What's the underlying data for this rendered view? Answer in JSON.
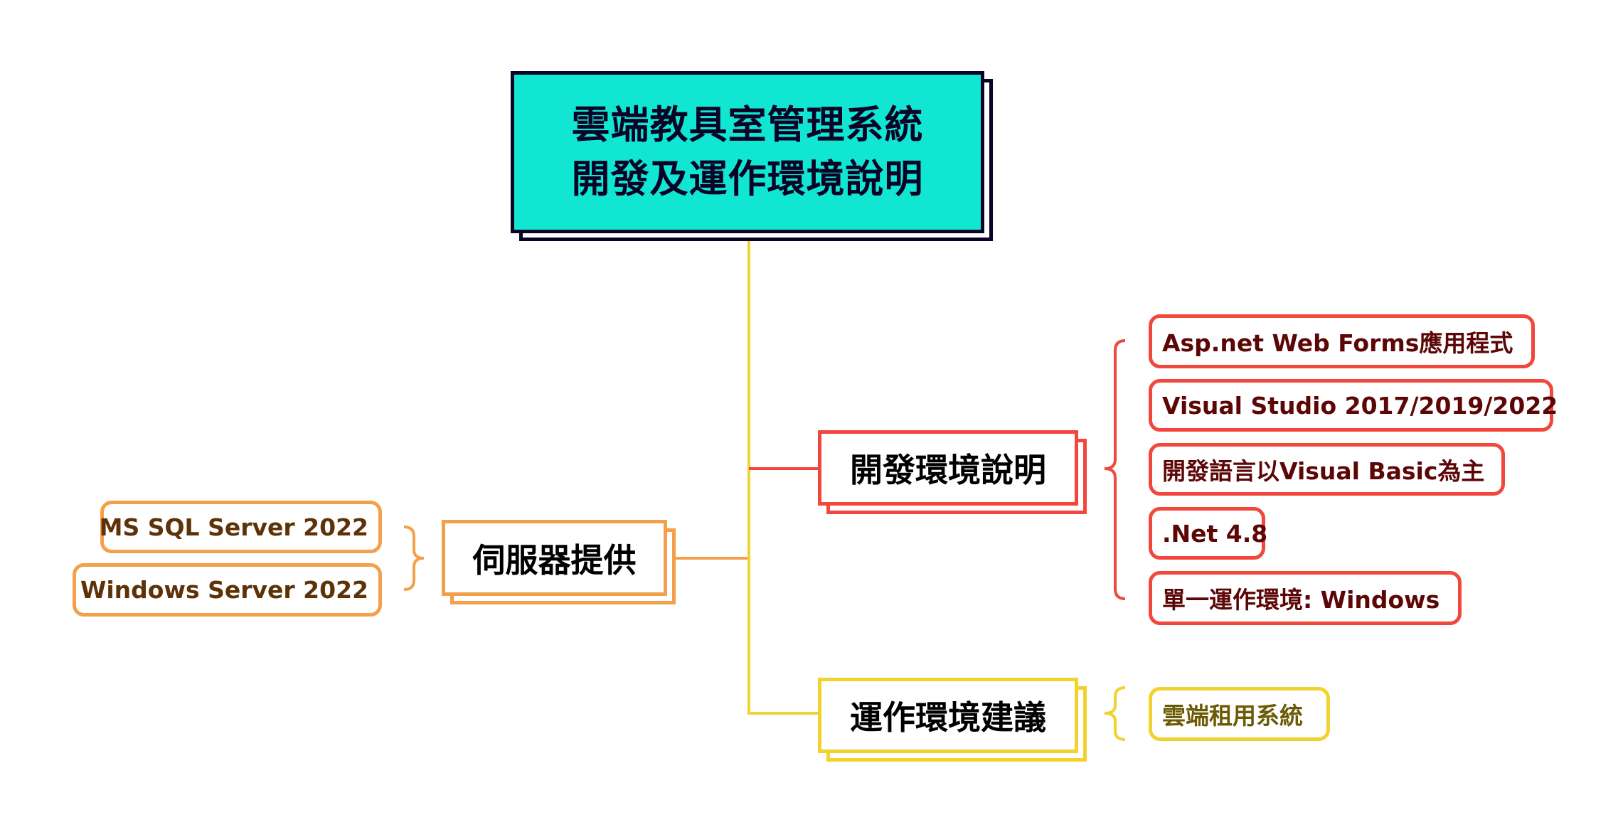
{
  "root": {
    "title_line1": "雲端教具室管理系統",
    "title_line2": "開發及運作環境說明"
  },
  "branches": {
    "dev": {
      "label": "開發環境說明",
      "color": "#f2473d",
      "leaves": [
        "Asp.net Web Forms應用程式",
        "Visual Studio 2017/2019/2022",
        "開發語言以Visual Basic為主",
        ".Net 4.8",
        "單一運作環境: Windows"
      ]
    },
    "server": {
      "label": "伺服器提供",
      "color": "#f4a04a",
      "leaves": [
        "MS SQL Server 2022",
        "Windows Server 2022"
      ]
    },
    "ops": {
      "label": "運作環境建議",
      "color": "#f2d22e",
      "leaves": [
        "雲端租用系統"
      ]
    }
  },
  "colors": {
    "root_fill": "#10e6d2",
    "root_border": "#0a0326",
    "trunk": "#f2d22e"
  }
}
